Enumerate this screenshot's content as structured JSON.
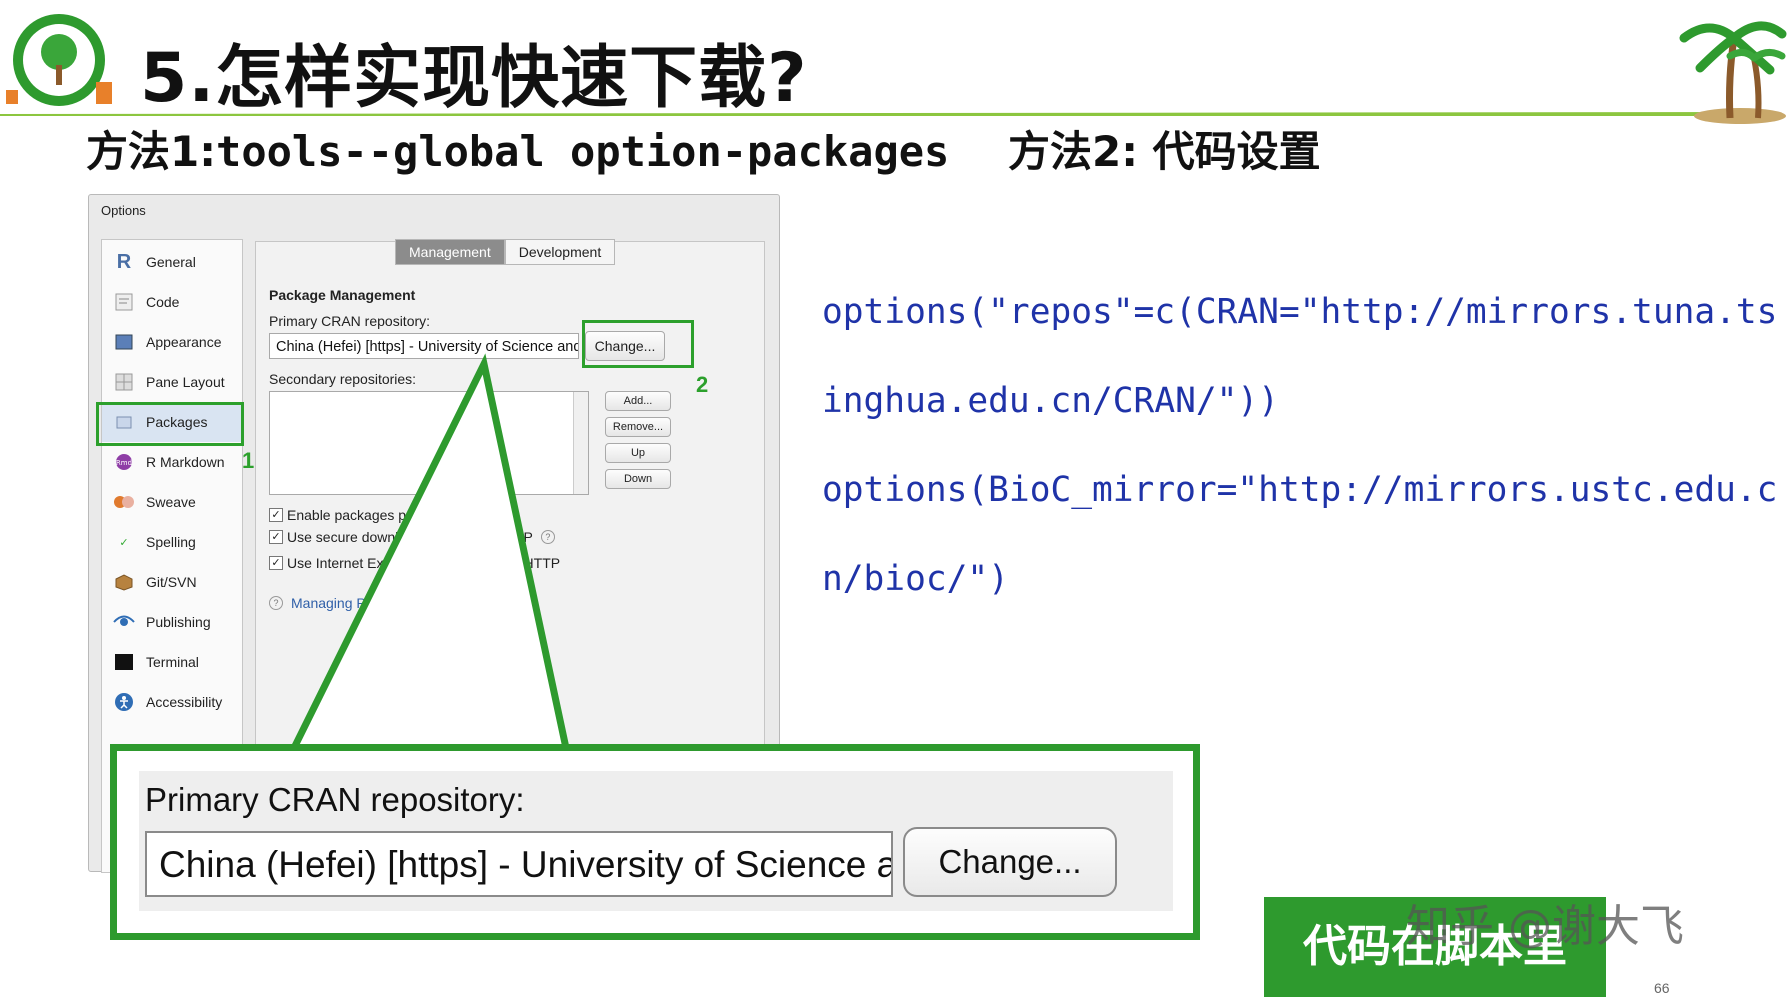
{
  "slide": {
    "title": "5.怎样实现快速下载?",
    "method1_prefix": "方法1:",
    "method1_code": "tools--global option-packages",
    "method2": "方法2: 代码设置",
    "page_number": "66",
    "banner_text": "代码在脚本里",
    "watermark": "知乎 @谢大飞",
    "accent_color": "#2e9a2e"
  },
  "dialog": {
    "title": "Options",
    "sidebar": [
      {
        "label": "General",
        "icon": "r-logo-icon"
      },
      {
        "label": "Code",
        "icon": "code-icon"
      },
      {
        "label": "Appearance",
        "icon": "appearance-icon"
      },
      {
        "label": "Pane Layout",
        "icon": "pane-layout-icon"
      },
      {
        "label": "Packages",
        "icon": "packages-icon"
      },
      {
        "label": "R Markdown",
        "icon": "rmarkdown-icon"
      },
      {
        "label": "Sweave",
        "icon": "sweave-icon"
      },
      {
        "label": "Spelling",
        "icon": "spelling-icon"
      },
      {
        "label": "Git/SVN",
        "icon": "git-icon"
      },
      {
        "label": "Publishing",
        "icon": "publishing-icon"
      },
      {
        "label": "Terminal",
        "icon": "terminal-icon"
      },
      {
        "label": "Accessibility",
        "icon": "accessibility-icon"
      }
    ],
    "selected": "Packages",
    "tabs": [
      "Management",
      "Development"
    ],
    "active_tab": "Management",
    "section_title": "Package Management",
    "primary_label": "Primary CRAN repository:",
    "primary_value": "China (Hefei) [https] - University of Science and Technology of China",
    "change_button": "Change...",
    "secondary_label": "Secondary repositories:",
    "secondary_buttons": [
      "Add...",
      "Remove...",
      "Up",
      "Down"
    ],
    "checkboxes": [
      {
        "label": "Enable packages pane",
        "checked": true
      },
      {
        "label": "Use secure download method for HTTP",
        "checked": true
      },
      {
        "label": "Use Internet Explorer library/proxy for HTTP",
        "checked": true
      }
    ],
    "help_link": "Managing Packages"
  },
  "annotations": {
    "n1": "1",
    "n2": "2"
  },
  "zoom": {
    "label": "Primary CRAN repository:",
    "value": "China (Hefei) [https] - University of Science a",
    "button": "Change..."
  },
  "code_lines": [
    "options(\"repos\"=c(CRAN=\"http://mirrors.tuna.ts",
    "inghua.edu.cn/CRAN/\"))",
    "options(BioC_mirror=\"http://mirrors.ustc.edu.c",
    "n/bioc/\")"
  ]
}
